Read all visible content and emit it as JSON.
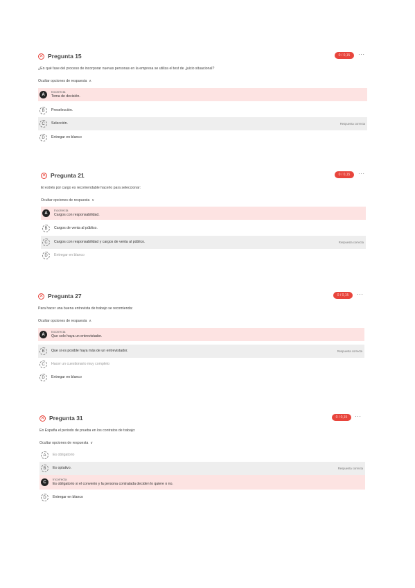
{
  "questions": [
    {
      "title": "Pregunta 15",
      "score": "0 / 0,15",
      "more": "···",
      "text": "¿En qué fase del proceso de incorporar nuevas personas en la empresa se utiliza el test de „juicio situacional?",
      "toggle_label": "Ocultar opciones de respuesta",
      "options": [
        {
          "letter": "A",
          "status": "Incorrecta",
          "text": "Toma de decisión."
        },
        {
          "letter": "B",
          "text": "Preselección."
        },
        {
          "letter": "C",
          "text": "Selección.",
          "tag": "Respuesta correcta"
        },
        {
          "letter": "D",
          "text": "Entregar en blanco"
        }
      ]
    },
    {
      "title": "Pregunta 21",
      "score": "0 / 0,15",
      "more": "···",
      "text": "El estrés por cargo es recomendable hacerlo para seleccionar:",
      "toggle_label": "Ocultar opciones de respuesta",
      "options": [
        {
          "letter": "A",
          "status": "Incorrecta",
          "text": "Cargos con responsabilidad."
        },
        {
          "letter": "B",
          "text": "Cargos de venta al público."
        },
        {
          "letter": "C",
          "text": "Cargos con responsabilidad y cargos de venta al público.",
          "tag": "Respuesta correcta"
        },
        {
          "letter": "D",
          "text": "Entregar en blanco"
        }
      ]
    },
    {
      "title": "Pregunta 27",
      "score": "0 / 0,15",
      "more": "···",
      "text": "Para hacer una buena entrevista de trabajo se recomienda:",
      "toggle_label": "Ocultar opciones de respuesta",
      "options": [
        {
          "letter": "A",
          "status": "Incorrecta",
          "text": "Que solo haya un entrevistador."
        },
        {
          "letter": "B",
          "text": "Que si es posible haya más de un entrevistador.",
          "tag": "Respuesta correcta"
        },
        {
          "letter": "C",
          "text": "Hacer un cuestionario muy completo",
          "faded": true
        },
        {
          "letter": "D",
          "text": "Entregar en blanco"
        }
      ]
    },
    {
      "title": "Pregunta 31",
      "score": "0 / 0,15",
      "more": "···",
      "text": "En España el periodo de prueba en los contratos de trabajo:",
      "toggle_label": "Ocultar opciones de respuesta",
      "options": [
        {
          "letter": "A",
          "text": "Es obligatorio",
          "faded": true
        },
        {
          "letter": "B",
          "text": "Es optativo.",
          "tag": "Respuesta correcta"
        },
        {
          "letter": "C",
          "status": "Incorrecta",
          "text": "Es obligatorio si el convenio y la persona contratada deciden lo quiere o no."
        },
        {
          "letter": "D",
          "text": "Entregar en blanco"
        }
      ]
    }
  ],
  "colors": {
    "wrong_bg": "#fde3e2",
    "correct_bg": "#eeeeee",
    "accent": "#e8453c"
  }
}
